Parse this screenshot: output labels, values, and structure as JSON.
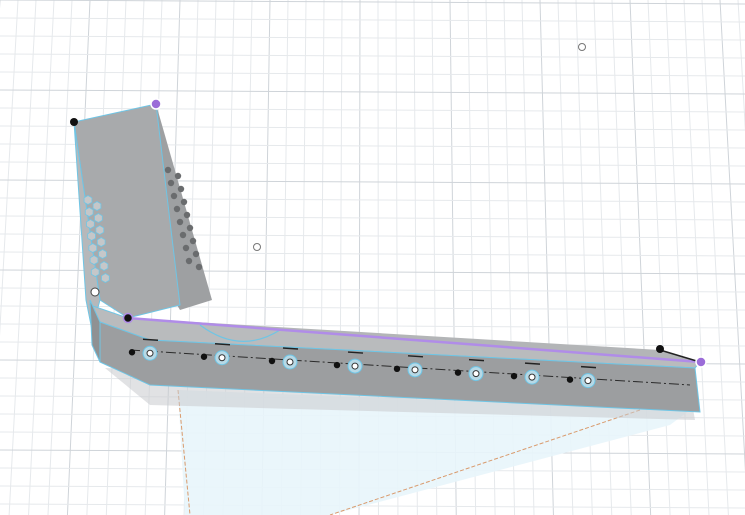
{
  "viewport": {
    "background": "#ffffff",
    "grid_minor_color": "#e6e9ec",
    "grid_major_color": "#cfd4d9"
  },
  "model": {
    "body_color": "#a3a5a7",
    "body_dark_color": "#8a8c8e",
    "face_light_color": "#bdbfc1",
    "edge_color": "#6fc5e5",
    "selected_edge_color": "#b08ce8",
    "hole_color": "#6a6c6e",
    "sketch_point_color": "#111111",
    "selected_point_color": "#9b6cd8",
    "center_line_color": "#2b2b2b",
    "projection_color": "#d7eef9",
    "projection_edge_color": "#d99a6c",
    "icons": {
      "sketch-point": "filled-dot",
      "construction-point": "hollow-circle",
      "constraint-marker": "horizontal-bar"
    }
  }
}
